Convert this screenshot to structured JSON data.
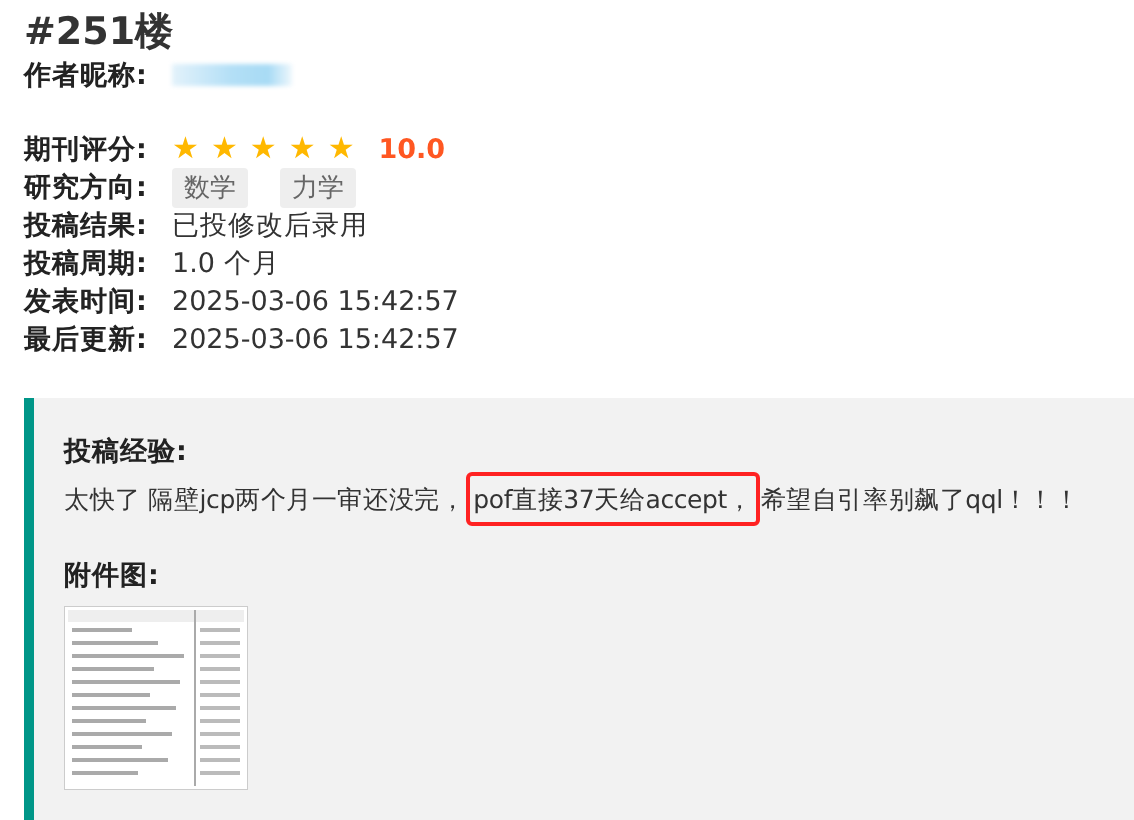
{
  "floor": "#251楼",
  "author": {
    "label": "作者昵称:"
  },
  "fields": [
    {
      "kind": "rating",
      "label": "期刊评分:",
      "stars": 5,
      "value": "10.0"
    },
    {
      "kind": "tags",
      "label": "研究方向:",
      "tags": [
        "数学",
        "力学"
      ]
    },
    {
      "kind": "text",
      "label": "投稿结果:",
      "value": "已投修改后录用"
    },
    {
      "kind": "text",
      "label": "投稿周期:",
      "value": "1.0 个月"
    },
    {
      "kind": "text",
      "label": "发表时间:",
      "value": "2025-03-06 15:42:57"
    },
    {
      "kind": "text",
      "label": "最后更新:",
      "value": "2025-03-06 15:42:57"
    }
  ],
  "experience": {
    "title": "投稿经验:",
    "parts": [
      {
        "text": "太快了 隔壁jcp两个月一审还没完，",
        "highlighted": false
      },
      {
        "text": "pof直接37天给accept，",
        "highlighted": true
      },
      {
        "text": "希望自引率别飙了qql！！！",
        "highlighted": false
      }
    ]
  },
  "attachment": {
    "title": "附件图:"
  }
}
